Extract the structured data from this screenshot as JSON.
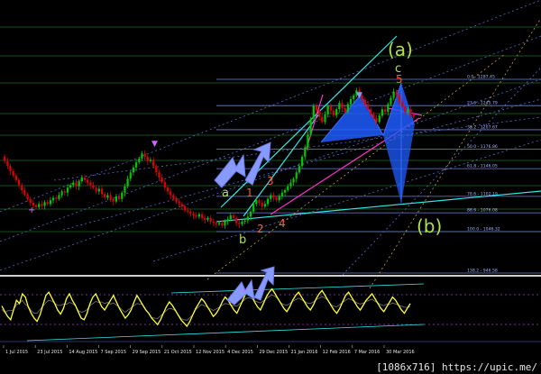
{
  "chart_data": {
    "type": "candlestick",
    "colors": {
      "background": "#000000",
      "bull": "#00c800",
      "bear": "#e00000",
      "grid_green": "#1f6b1f",
      "fib": "#6f7fd6",
      "channel": "#33e6e6",
      "magenta": "#ff33cc",
      "oscillator": "#ffff33",
      "wave_green": "#aee04a",
      "wave_red": "#ff5a3a",
      "harmonic_fill": "#1e5cff"
    },
    "x_tick_labels": [
      "1 Jul 2015",
      "23 Jul 2015",
      "14 Aug 2015",
      "7 Sep 2015",
      "29 Sep 2015",
      "21 Oct 2015",
      "12 Nov 2015",
      "4 Dec 2015",
      "29 Dec 2015",
      "21 Jan 2016",
      "12 Feb 2016",
      "7 Mar 2016",
      "30 Mar 2016"
    ],
    "fib_levels": [
      {
        "label": "0.0 - 1287.45",
        "price": 1287.45
      },
      {
        "label": "23.6 - 1245.79",
        "price": 1245.79
      },
      {
        "label": "38.2 - 1207.67",
        "price": 1207.67
      },
      {
        "label": "50.0 - 1176.86",
        "price": 1176.86
      },
      {
        "label": "61.8 - 1146.05",
        "price": 1146.05
      },
      {
        "label": "78.6 - 1102.19",
        "price": 1102.19
      },
      {
        "label": "88.6 - 1076.08",
        "price": 1076.08
      },
      {
        "label": "100.0 - 1046.32",
        "price": 1046.32
      },
      {
        "label": "138.2 - 946.58",
        "price": 946.58
      }
    ],
    "wave_labels_green": [
      "(a)",
      "c",
      "a",
      "b",
      "(b)"
    ],
    "wave_labels_red": [
      "5",
      "1",
      "3",
      "2",
      "4"
    ],
    "price_path": [
      1165,
      1158,
      1150,
      1142,
      1135,
      1128,
      1120,
      1112,
      1105,
      1098,
      1092,
      1088,
      1085,
      1090,
      1087,
      1093,
      1090,
      1096,
      1100,
      1098,
      1104,
      1110,
      1108,
      1116,
      1120,
      1124,
      1118,
      1126,
      1132,
      1128,
      1124,
      1120,
      1116,
      1110,
      1114,
      1106,
      1100,
      1104,
      1098,
      1094,
      1102,
      1098,
      1108,
      1118,
      1130,
      1140,
      1148,
      1156,
      1162,
      1170,
      1165,
      1158,
      1160,
      1150,
      1140,
      1132,
      1125,
      1116,
      1110,
      1104,
      1098,
      1094,
      1090,
      1086,
      1080,
      1078,
      1075,
      1072,
      1070,
      1074,
      1068,
      1065,
      1068,
      1062,
      1060,
      1058,
      1060,
      1056,
      1063,
      1066,
      1072,
      1068,
      1060,
      1058,
      1062,
      1064,
      1070,
      1078,
      1090,
      1096,
      1092,
      1086,
      1090,
      1098,
      1104,
      1100,
      1096,
      1102,
      1108,
      1112,
      1118,
      1124,
      1130,
      1140,
      1150,
      1165,
      1180,
      1200,
      1225,
      1245,
      1238,
      1228,
      1220,
      1232,
      1245,
      1238,
      1230,
      1240,
      1250,
      1242,
      1236,
      1248,
      1256,
      1262,
      1270,
      1262,
      1255,
      1248,
      1240,
      1232,
      1226,
      1220,
      1230,
      1240,
      1236,
      1248,
      1258,
      1268,
      1262,
      1252,
      1244,
      1236,
      1240,
      1232,
      1228
    ],
    "oscillator_values": [
      45,
      38,
      32,
      28,
      40,
      52,
      48,
      60,
      56,
      44,
      36,
      30,
      26,
      34,
      46,
      58,
      62,
      55,
      48,
      40,
      35,
      42,
      54,
      60,
      52,
      46,
      38,
      30,
      28,
      36,
      48,
      56,
      60,
      52,
      44,
      40,
      46,
      52,
      58,
      50,
      42,
      36,
      30,
      34,
      40,
      50,
      58,
      52,
      46,
      40,
      36,
      30,
      26,
      22,
      28,
      36,
      44,
      50,
      46,
      40,
      34,
      28,
      24,
      20,
      26,
      34,
      42,
      48,
      54,
      50,
      44,
      38,
      32,
      36,
      42,
      50,
      56,
      52,
      46,
      40,
      36,
      44,
      52,
      60,
      64,
      58,
      50,
      44,
      40,
      48,
      56,
      62,
      66,
      60,
      54,
      48,
      42,
      38,
      44,
      52,
      58,
      62,
      56,
      50,
      44,
      40,
      46,
      54,
      60,
      64,
      58,
      52,
      46,
      40,
      36,
      42,
      50,
      58,
      62,
      56,
      50,
      44,
      40,
      46,
      52,
      56,
      60,
      54,
      48,
      42,
      38,
      44,
      50,
      56,
      52,
      46,
      40,
      36,
      42,
      48
    ]
  }
}
